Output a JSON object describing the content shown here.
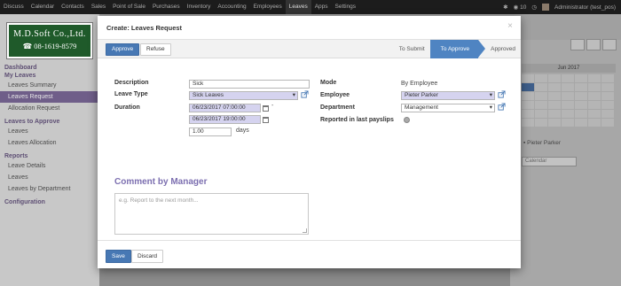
{
  "topbar": {
    "menu": [
      "Discuss",
      "Calendar",
      "Contacts",
      "Sales",
      "Point of Sale",
      "Purchases",
      "Inventory",
      "Accounting",
      "Employees",
      "Leaves",
      "Apps",
      "Settings"
    ],
    "active_menu": "Leaves",
    "notifications": "10",
    "user": "Administrator (test_pos)"
  },
  "logo": {
    "line1": "M.D.Soft Co.,Ltd.",
    "line2": "☎ 08-1619-8579"
  },
  "sidebar": {
    "sections": [
      {
        "title": "Dashboard"
      },
      {
        "title": "My Leaves",
        "items": [
          "Leaves Summary",
          "Leaves Request",
          "Allocation Request"
        ]
      },
      {
        "title": "Leaves to Approve",
        "items": [
          "Leaves",
          "Leaves Allocation"
        ]
      },
      {
        "title": "Reports",
        "items": [
          "Leave Details",
          "Leaves",
          "Leaves by Department"
        ]
      },
      {
        "title": "Configuration"
      }
    ],
    "active_item": "Leaves Request"
  },
  "background": {
    "calendar_month": "Jun 2017",
    "person": "Pieter Parker",
    "calendar_select": "Calendar"
  },
  "modal": {
    "title": "Create: Leaves Request",
    "close": "×",
    "buttons": {
      "approve": "Approve",
      "refuse": "Refuse"
    },
    "statusbar": [
      "To Submit",
      "To Approve",
      "Approved"
    ],
    "current_status": "To Approve",
    "form": {
      "description_label": "Description",
      "description_value": "Sick",
      "leave_type_label": "Leave Type",
      "leave_type_value": "Sick Leaves",
      "duration_label": "Duration",
      "date_from": "06/23/2017 07:00:00",
      "date_to": "06/23/2017 19:00:00",
      "duration_days": "1.00",
      "days_unit": "days",
      "dash": "-",
      "mode_label": "Mode",
      "mode_value": "By Employee",
      "employee_label": "Employee",
      "employee_value": "Pieter Parker",
      "department_label": "Department",
      "department_value": "Management",
      "reported_label": "Reported in last payslips"
    },
    "comment": {
      "title": "Comment by Manager",
      "placeholder": "e.g. Report to the next month..."
    },
    "footer": {
      "save": "Save",
      "discard": "Discard"
    }
  },
  "colors": {
    "primary": "#4778b4",
    "status_active": "#4f84c2",
    "required_field": "#d5d3ef",
    "comment_title": "#7c6fb0",
    "sidebar_active": "#6f5e89"
  }
}
